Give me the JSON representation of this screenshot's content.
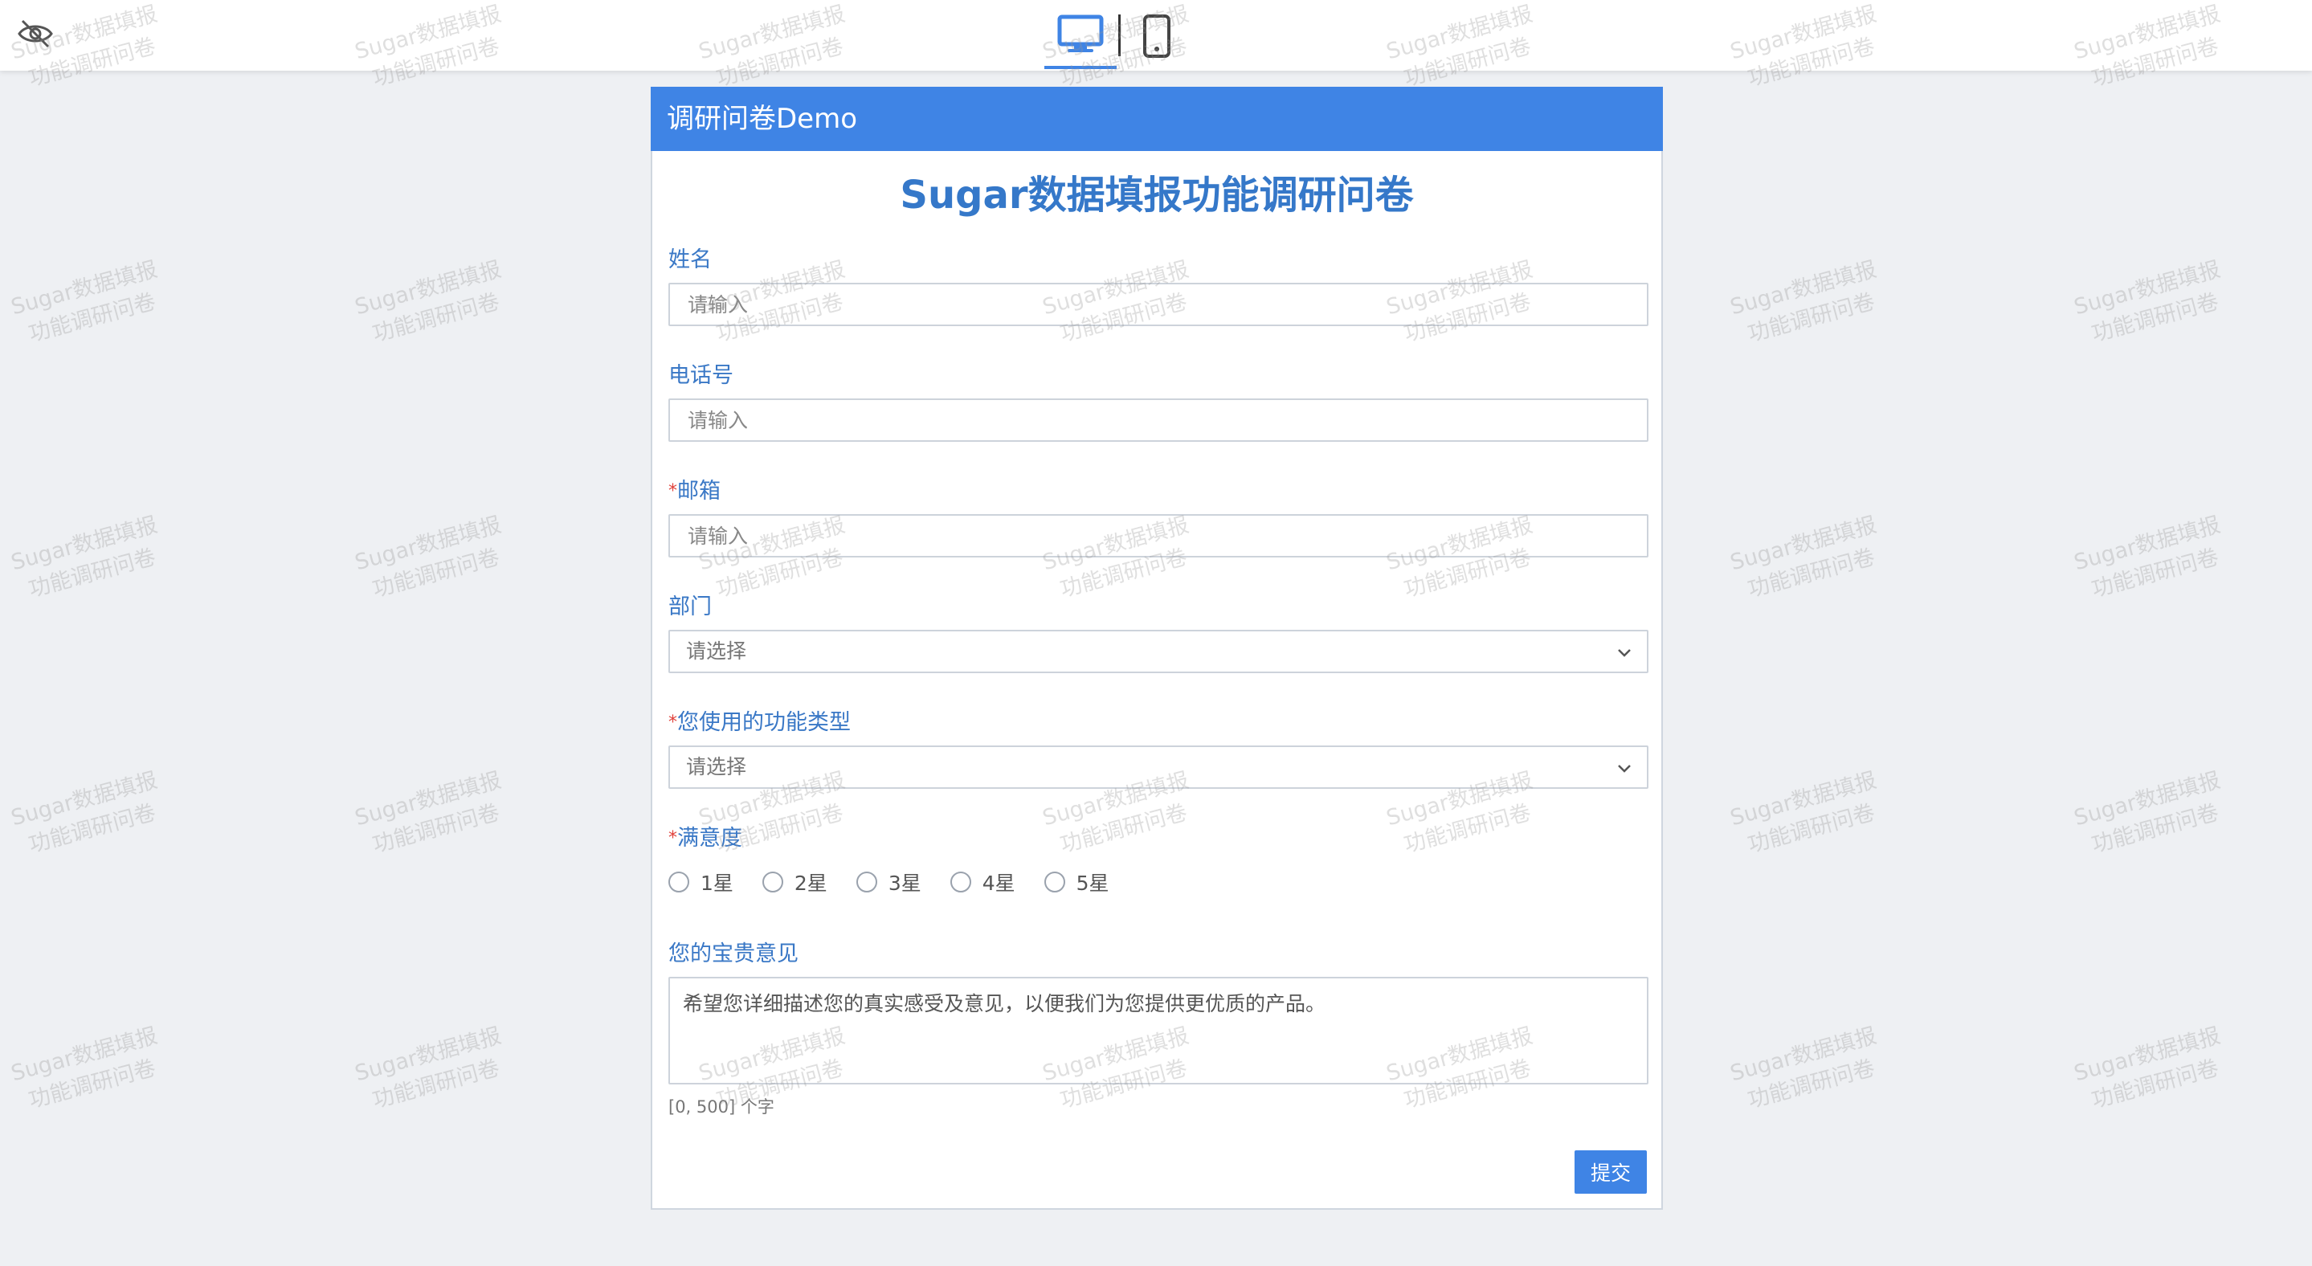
{
  "topbar": {
    "hide_watermark_icon": "eye-off-icon",
    "device_modes": [
      {
        "name": "desktop",
        "icon": "desktop-icon",
        "active": true
      },
      {
        "name": "mobile",
        "icon": "mobile-icon",
        "active": false
      }
    ]
  },
  "form": {
    "header_title": "调研问卷Demo",
    "title": "Sugar数据填报功能调研问卷",
    "fields": {
      "name": {
        "label": "姓名",
        "placeholder": "请输入",
        "required": false
      },
      "phone": {
        "label": "电话号",
        "placeholder": "请输入",
        "required": false
      },
      "email": {
        "label": "邮箱",
        "placeholder": "请输入",
        "required": true
      },
      "department": {
        "label": "部门",
        "placeholder": "请选择",
        "required": false
      },
      "feature_type": {
        "label": "您使用的功能类型",
        "placeholder": "请选择",
        "required": true
      },
      "satisfaction": {
        "label": "满意度",
        "required": true,
        "options": [
          "1星",
          "2星",
          "3星",
          "4星",
          "5星"
        ]
      },
      "feedback": {
        "label": "您的宝贵意见",
        "placeholder": "希望您详细描述您的真实感受及意见，以便我们为您提供更优质的产品。",
        "hint": "[0, 500] 个字"
      }
    },
    "required_mark": "*",
    "submit_label": "提交"
  },
  "watermark": {
    "line1": "Sugar数据填报",
    "line2": "功能调研问卷"
  },
  "colors": {
    "accent": "#3f84e5",
    "label": "#3a78c6",
    "required": "#e0403a",
    "background": "#eef0f3"
  }
}
